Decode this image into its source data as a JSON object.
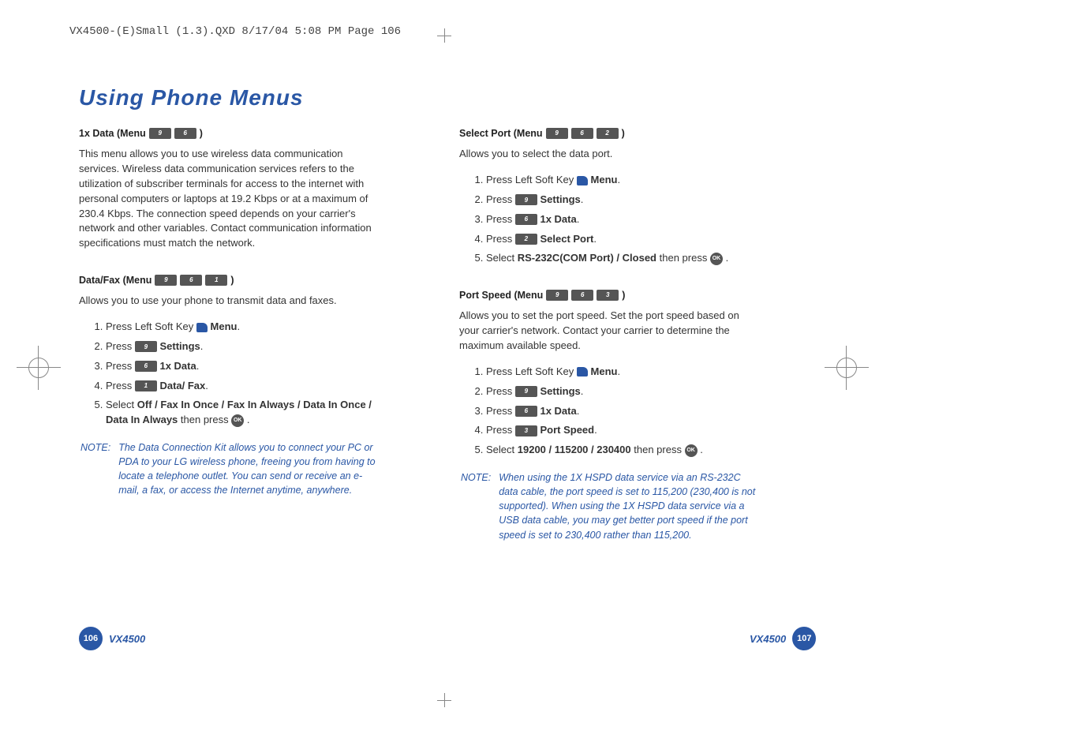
{
  "header": "VX4500-(E)Small (1.3).QXD  8/17/04  5:08 PM  Page 106",
  "page_title": "Using Phone Menus",
  "left": {
    "s1": {
      "head_pre": "1x Data (Menu",
      "head_post": ")",
      "keys": [
        "9",
        "6"
      ],
      "intro": "This menu allows you to use wireless data communication services. Wireless data communication services refers to the utilization of subscriber terminals for access to the internet with personal computers or laptops at 19.2 Kbps or at a maximum of 230.4 Kbps. The connection speed depends on your carrier's network and other variables. Contact communication information specifications must match the network."
    },
    "s2": {
      "head_pre": "Data/Fax (Menu",
      "head_post": ")",
      "keys": [
        "9",
        "6",
        "1"
      ],
      "intro": "Allows you to use your phone to transmit data and faxes.",
      "steps": {
        "1_pre": "Press Left Soft Key ",
        "1_post": " Menu",
        "2_pre": "Press ",
        "2_key": "9",
        "2_post": " Settings",
        "3_pre": "Press ",
        "3_key": "6",
        "3_post": " 1x Data",
        "4_pre": "Press ",
        "4_key": "1",
        "4_post": " Data/ Fax",
        "5_pre": "Select ",
        "5_opts": "Off / Fax In Once / Fax In Always / Data In Once / Data In Always",
        "5_mid": " then press ",
        "5_post": " ."
      },
      "note_label": "NOTE:",
      "note": "The Data Connection Kit allows you to connect your PC or PDA to your LG wireless phone, freeing you from having to locate a telephone outlet. You can send or receive an e-mail, a fax, or access the Internet anytime, anywhere."
    }
  },
  "right": {
    "s1": {
      "head_pre": "Select Port (Menu",
      "head_post": ")",
      "keys": [
        "9",
        "6",
        "2"
      ],
      "intro": "Allows you to select the data port.",
      "steps": {
        "1_pre": "Press Left Soft Key ",
        "1_post": " Menu",
        "2_pre": "Press ",
        "2_key": "9",
        "2_post": " Settings",
        "3_pre": "Press ",
        "3_key": "6",
        "3_post": " 1x Data",
        "4_pre": "Press ",
        "4_key": "2",
        "4_post": " Select Port",
        "5_pre": "Select ",
        "5_opts": "RS-232C(COM Port) / Closed",
        "5_mid": " then press ",
        "5_post": " ."
      }
    },
    "s2": {
      "head_pre": "Port Speed (Menu",
      "head_post": ")",
      "keys": [
        "9",
        "6",
        "3"
      ],
      "intro": "Allows you to set the port speed. Set the port speed based on your carrier's network. Contact your carrier to determine the maximum available speed.",
      "steps": {
        "1_pre": "Press Left Soft Key ",
        "1_post": " Menu",
        "2_pre": "Press ",
        "2_key": "9",
        "2_post": " Settings",
        "3_pre": "Press ",
        "3_key": "6",
        "3_post": " 1x Data",
        "4_pre": "Press ",
        "4_key": "3",
        "4_post": " Port Speed",
        "5_pre": "Select ",
        "5_opts": "19200 / 115200 / 230400",
        "5_mid": " then press ",
        "5_post": " ."
      },
      "note_label": "NOTE:",
      "note": "When using the 1X HSPD data service via an RS-232C data cable, the port speed is set to 115,200 (230,400 is not supported). When using the 1X HSPD data service via a USB data cable, you may get better port speed if the port speed is set to 230,400 rather than 115,200."
    }
  },
  "footer": {
    "model": "VX4500",
    "page_left": "106",
    "page_right": "107"
  },
  "glyph": {
    "ok": "OK"
  }
}
